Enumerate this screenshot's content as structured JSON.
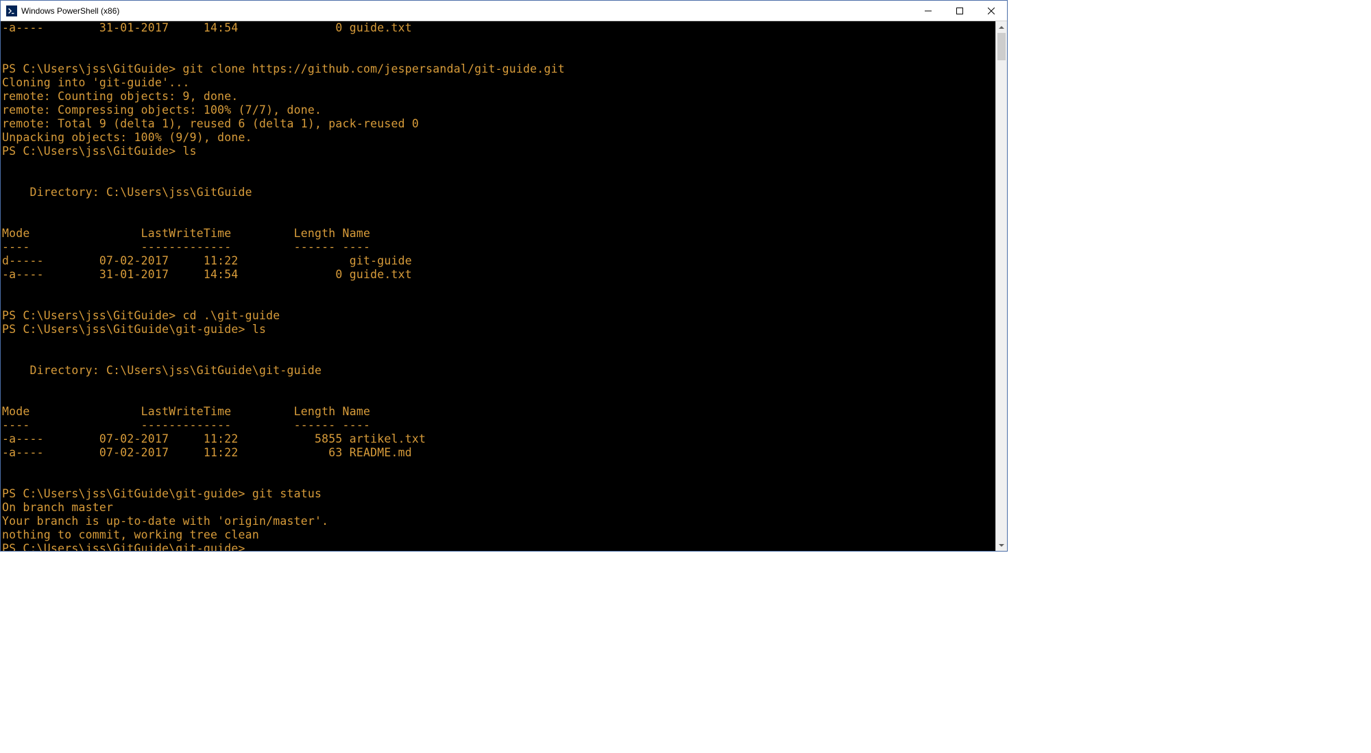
{
  "window": {
    "title": "Windows PowerShell (x86)"
  },
  "terminal": {
    "lines": [
      "-a----        31-01-2017     14:54              0 guide.txt",
      "",
      "",
      "PS C:\\Users\\jss\\GitGuide> git clone https://github.com/jespersandal/git-guide.git",
      "Cloning into 'git-guide'...",
      "remote: Counting objects: 9, done.",
      "remote: Compressing objects: 100% (7/7), done.",
      "remote: Total 9 (delta 1), reused 6 (delta 1), pack-reused 0",
      "Unpacking objects: 100% (9/9), done.",
      "PS C:\\Users\\jss\\GitGuide> ls",
      "",
      "",
      "    Directory: C:\\Users\\jss\\GitGuide",
      "",
      "",
      "Mode                LastWriteTime         Length Name",
      "----                -------------         ------ ----",
      "d-----        07-02-2017     11:22                git-guide",
      "-a----        31-01-2017     14:54              0 guide.txt",
      "",
      "",
      "PS C:\\Users\\jss\\GitGuide> cd .\\git-guide",
      "PS C:\\Users\\jss\\GitGuide\\git-guide> ls",
      "",
      "",
      "    Directory: C:\\Users\\jss\\GitGuide\\git-guide",
      "",
      "",
      "Mode                LastWriteTime         Length Name",
      "----                -------------         ------ ----",
      "-a----        07-02-2017     11:22           5855 artikel.txt",
      "-a----        07-02-2017     11:22             63 README.md",
      "",
      "",
      "PS C:\\Users\\jss\\GitGuide\\git-guide> git status",
      "On branch master",
      "Your branch is up-to-date with 'origin/master'.",
      "nothing to commit, working tree clean",
      "PS C:\\Users\\jss\\GitGuide\\git-guide>"
    ]
  }
}
